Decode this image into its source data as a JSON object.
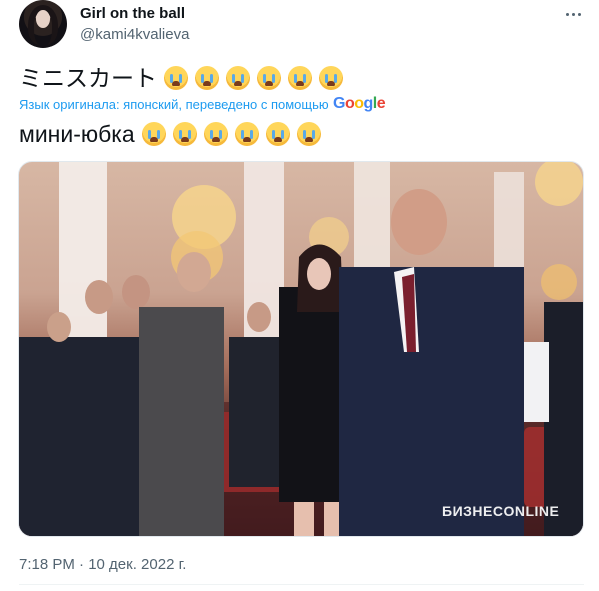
{
  "author": {
    "name": "Girl on the ball",
    "handle": "@kami4kvalieva"
  },
  "tweet": {
    "original_text": "ミニスカート",
    "translation_note": "Язык оригинала: японский, переведено с помощью",
    "translation_provider": "Google",
    "translated_text": "мини-юбка",
    "emoji": [
      "loudly-crying-face",
      "loudly-crying-face",
      "loudly-crying-face",
      "loudly-crying-face",
      "loudly-crying-face",
      "loudly-crying-face"
    ],
    "timestamp": "7:18 PM · 10 дек. 2022 г."
  },
  "media": {
    "watermark": "БИЗНЕСONLINE"
  },
  "colors": {
    "link": "#1d9bf0",
    "secondary_text": "#536471",
    "primary_text": "#0f1419"
  }
}
